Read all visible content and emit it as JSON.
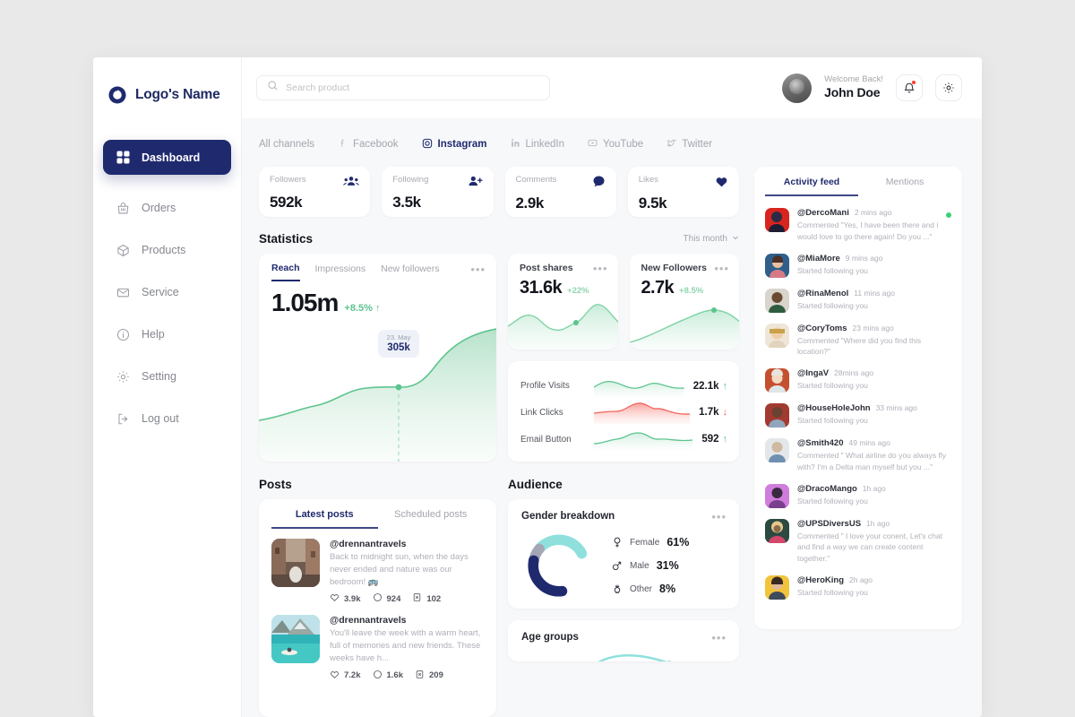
{
  "brand": {
    "name": "Logo's Name",
    "color": "#1f2a6e",
    "accent_green": "#5cc48e",
    "accent_teal": "#8fe0dd",
    "accent_red": "#f4635c"
  },
  "sidebar": {
    "items": [
      {
        "label": "Dashboard",
        "icon": "grid-icon",
        "active": true
      },
      {
        "label": "Orders",
        "icon": "bag-icon",
        "active": false
      },
      {
        "label": "Products",
        "icon": "box-icon",
        "active": false
      },
      {
        "label": "Service",
        "icon": "mail-icon",
        "active": false
      },
      {
        "label": "Help",
        "icon": "info-icon",
        "active": false
      },
      {
        "label": "Setting",
        "icon": "gear-icon",
        "active": false
      },
      {
        "label": "Log out",
        "icon": "logout-icon",
        "active": false
      }
    ]
  },
  "topbar": {
    "search": {
      "value": "",
      "placeholder": "Search product"
    },
    "welcome_small": "Welcome Back!",
    "welcome_name": "John Doe",
    "notification_has_alert": true
  },
  "channels": [
    {
      "label": "All channels",
      "icon": "",
      "active": false
    },
    {
      "label": "Facebook",
      "icon": "facebook-icon",
      "active": false
    },
    {
      "label": "Instagram",
      "icon": "instagram-icon",
      "active": true
    },
    {
      "label": "LinkedIn",
      "icon": "linkedin-icon",
      "active": false
    },
    {
      "label": "YouTube",
      "icon": "youtube-icon",
      "active": false
    },
    {
      "label": "Twitter",
      "icon": "twitter-icon",
      "active": false
    }
  ],
  "stat_cards": [
    {
      "label": "Followers",
      "value": "592k",
      "icon": "group-icon"
    },
    {
      "label": "Following",
      "value": "3.5k",
      "icon": "person-add-icon"
    },
    {
      "label": "Comments",
      "value": "2.9k",
      "icon": "comment-icon"
    },
    {
      "label": "Likes",
      "value": "9.5k",
      "icon": "heart-icon"
    }
  ],
  "statistics": {
    "title": "Statistics",
    "period": "This month",
    "reach": {
      "tabs": [
        {
          "label": "Reach",
          "active": true
        },
        {
          "label": "Impressions",
          "active": false
        },
        {
          "label": "New followers",
          "active": false
        }
      ],
      "value": "1.05m",
      "delta": "+8.5% ↑",
      "tooltip": {
        "date": "23. May",
        "value": "305k"
      }
    },
    "post_shares": {
      "title": "Post shares",
      "value": "31.6k",
      "delta": "+22%"
    },
    "new_followers": {
      "title": "New Followers",
      "value": "2.7k",
      "delta": "+8.5%"
    },
    "metrics": [
      {
        "name": "Profile Visits",
        "value": "22.1k",
        "trend": "up"
      },
      {
        "name": "Link Clicks",
        "value": "1.7k",
        "trend": "down"
      },
      {
        "name": "Email Button",
        "value": "592",
        "trend": "up"
      }
    ]
  },
  "posts": {
    "title": "Posts",
    "tabs": [
      {
        "label": "Latest posts",
        "active": true
      },
      {
        "label": "Scheduled posts",
        "active": false
      }
    ],
    "items": [
      {
        "user": "@drennantravels",
        "text": "Back to midnight sun, when the days never ended and nature was our bedroom! 🚌",
        "likes": "3.9k",
        "comments": "924",
        "saves": "102",
        "thumb": "alley-photo"
      },
      {
        "user": "@drennantravels",
        "text": "You'll leave the week with a warm heart, full of memories and new friends. These weeks have h...",
        "likes": "7.2k",
        "comments": "1.6k",
        "saves": "209",
        "thumb": "lake-photo"
      }
    ]
  },
  "audience": {
    "title": "Audience",
    "gender": {
      "title": "Gender breakdown",
      "items": [
        {
          "icon": "female-icon",
          "label": "Female",
          "value": "61%",
          "color": "#1f2a6e",
          "pct": 61
        },
        {
          "icon": "male-icon",
          "label": "Male",
          "value": "31%",
          "color": "#8fe0dd",
          "pct": 31
        },
        {
          "icon": "other-gender-icon",
          "label": "Other",
          "value": "8%",
          "color": "#a3a7b5",
          "pct": 8
        }
      ]
    },
    "age_groups": {
      "title": "Age groups"
    }
  },
  "feed": {
    "tabs": [
      {
        "label": "Activity feed",
        "active": true
      },
      {
        "label": "Mentions",
        "active": false
      }
    ],
    "items": [
      {
        "user": "@DercoMani",
        "time": "2 mins ago",
        "text": "Commented \"Yes, I have been there and i would love to go there again! Do you ...\"",
        "online": true,
        "av": "a1"
      },
      {
        "user": "@MiaMore",
        "time": "9 mins ago",
        "text": "Started following you",
        "online": false,
        "av": "a2"
      },
      {
        "user": "@RinaMenol",
        "time": "11 mins ago",
        "text": "Started following you",
        "online": false,
        "av": "a3"
      },
      {
        "user": "@CoryToms",
        "time": "23 mins ago",
        "text": "Commented \"Where did you find this location?\"",
        "online": false,
        "av": "a4"
      },
      {
        "user": "@IngaV",
        "time": "28mins ago",
        "text": "Started following you",
        "online": false,
        "av": "a5"
      },
      {
        "user": "@HouseHoleJohn",
        "time": "33 mins ago",
        "text": "Started following you",
        "online": false,
        "av": "a6"
      },
      {
        "user": "@Smith420",
        "time": "49 mins ago",
        "text": "Commented \" What airline do you always fly with? I'm a Delta man myself but you ...\"",
        "online": false,
        "av": "a7"
      },
      {
        "user": "@DracoMango",
        "time": "1h ago",
        "text": "Started following you",
        "online": false,
        "av": "a8"
      },
      {
        "user": "@UPSDiversUS",
        "time": "1h ago",
        "text": "Commented \" I love your conent, Let's chat and find a way we can create content together.\"",
        "online": false,
        "av": "a9"
      },
      {
        "user": "@HeroKing",
        "time": "2h ago",
        "text": "Started following you",
        "online": false,
        "av": "a10"
      }
    ]
  },
  "chart_data": [
    {
      "type": "area",
      "title": "Reach",
      "xlabel": "",
      "ylabel": "",
      "x": [
        "1",
        "5",
        "9",
        "13",
        "17",
        "21",
        "23",
        "25",
        "29",
        "31"
      ],
      "values": [
        120,
        150,
        175,
        185,
        230,
        295,
        305,
        320,
        560,
        700
      ],
      "annotation": {
        "x": "23",
        "label": "23. May",
        "value": "305k"
      },
      "total": "1.05m",
      "delta_pct": 8.5,
      "grid": false,
      "legend": "none"
    },
    {
      "type": "area",
      "title": "Post shares",
      "x": [
        "1",
        "2",
        "3",
        "4",
        "5",
        "6",
        "7",
        "8"
      ],
      "values": [
        26,
        40,
        30,
        22,
        26,
        36,
        52,
        30
      ],
      "total": "31.6k",
      "delta_pct": 22,
      "grid": false,
      "legend": "none"
    },
    {
      "type": "area",
      "title": "New Followers",
      "x": [
        "1",
        "2",
        "3",
        "4",
        "5",
        "6",
        "7",
        "8"
      ],
      "values": [
        5,
        12,
        20,
        28,
        36,
        40,
        38,
        30
      ],
      "total": "2.7k",
      "delta_pct": 8.5,
      "grid": false,
      "legend": "none"
    },
    {
      "type": "area",
      "title": "Profile Visits",
      "x": [
        "1",
        "2",
        "3",
        "4",
        "5",
        "6",
        "7",
        "8",
        "9"
      ],
      "values": [
        18,
        22,
        16,
        20,
        24,
        17,
        21,
        18,
        20
      ],
      "total": "22.1k",
      "trend": "up",
      "color": "#5cc48e"
    },
    {
      "type": "area",
      "title": "Link Clicks",
      "x": [
        "1",
        "2",
        "3",
        "4",
        "5",
        "6",
        "7",
        "8",
        "9"
      ],
      "values": [
        14,
        15,
        18,
        28,
        26,
        20,
        24,
        12,
        13
      ],
      "total": "1.7k",
      "trend": "down",
      "color": "#f4635c"
    },
    {
      "type": "area",
      "title": "Email Button",
      "x": [
        "1",
        "2",
        "3",
        "4",
        "5",
        "6",
        "7",
        "8",
        "9"
      ],
      "values": [
        12,
        14,
        20,
        17,
        24,
        18,
        22,
        16,
        18
      ],
      "total": "592",
      "trend": "up",
      "color": "#5cc48e"
    },
    {
      "type": "pie",
      "title": "Gender breakdown",
      "categories": [
        "Female",
        "Male",
        "Other"
      ],
      "values": [
        61,
        31,
        8
      ],
      "colors": [
        "#1f2a6e",
        "#8fe0dd",
        "#a3a7b5"
      ],
      "legend": "right",
      "donut": true
    }
  ]
}
